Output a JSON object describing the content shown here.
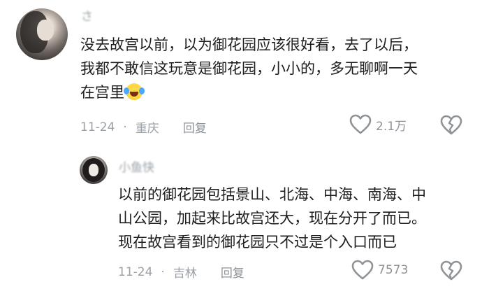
{
  "comments": [
    {
      "username": "さ",
      "text": "没去故宫以前，以为御花园应该很好看，去了以后，\n我都不敢信这玩意是御花园，小小的，多无聊啊一天\n在宫里",
      "emoji": "rolling-on-floor-laughing",
      "date": "11-24",
      "dot": "·",
      "location": "重庆",
      "reply_label": "回复",
      "likes": "2.1万"
    },
    {
      "username": "小鱼快",
      "text": "以前的御花园包括景山、北海、中海、南海、中\n山公园，加起来比故宫还大，现在分开了而已。\n现在故宫看到的御花园只不过是个入口而已",
      "date": "11-24",
      "dot": "·",
      "location": "吉林",
      "reply_label": "回复",
      "likes": "7573"
    }
  ],
  "colors": {
    "text": "#1d1d1f",
    "meta": "#9aa0a6",
    "icon": "#8e9398"
  },
  "icons": {
    "like": "heart-outline-icon",
    "dislike": "broken-heart-icon"
  }
}
